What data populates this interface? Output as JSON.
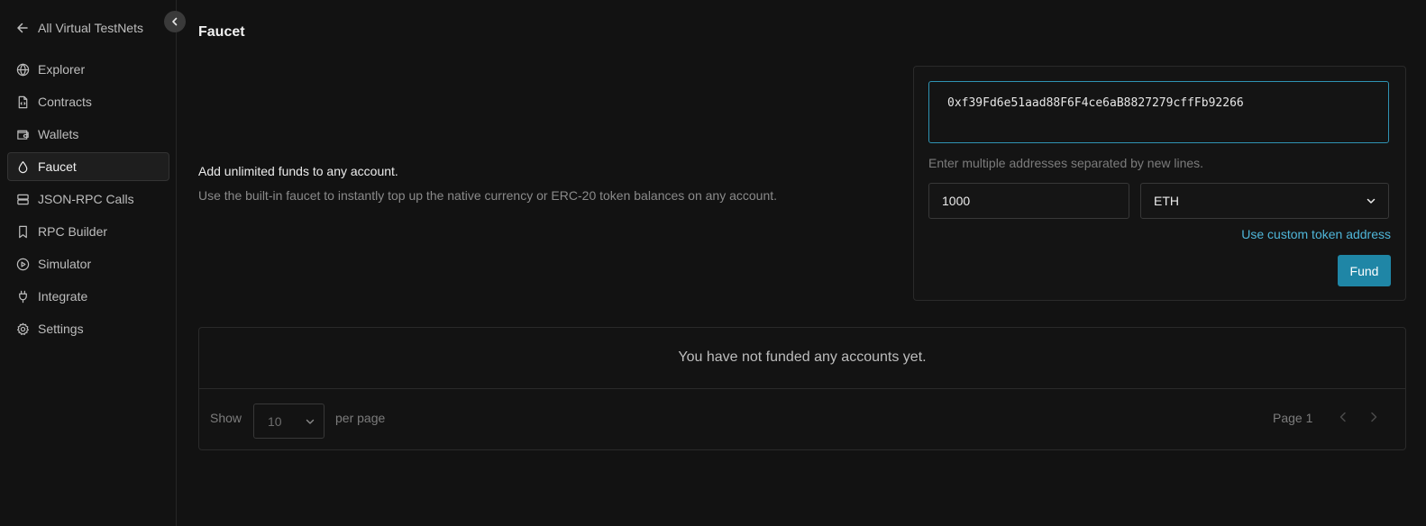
{
  "sidebar": {
    "back_label": "All Virtual TestNets",
    "back_icon": "arrow-left-icon",
    "collapse_icon": "chevron-left-icon",
    "items": [
      {
        "label": "Explorer",
        "icon": "globe-icon"
      },
      {
        "label": "Contracts",
        "icon": "file-code-icon"
      },
      {
        "label": "Wallets",
        "icon": "wallet-icon"
      },
      {
        "label": "Faucet",
        "icon": "droplet-icon",
        "active": true
      },
      {
        "label": "JSON-RPC Calls",
        "icon": "server-icon"
      },
      {
        "label": "RPC Builder",
        "icon": "bookmark-icon"
      },
      {
        "label": "Simulator",
        "icon": "play-circle-icon"
      },
      {
        "label": "Integrate",
        "icon": "plug-icon"
      },
      {
        "label": "Settings",
        "icon": "gear-icon"
      }
    ]
  },
  "page": {
    "title": "Faucet"
  },
  "intro": {
    "title": "Add unlimited funds to any account.",
    "description": "Use the built-in faucet to instantly top up the native currency or ERC-20 token balances on any account."
  },
  "fund_form": {
    "address_value": "0xf39Fd6e51aad88F6F4ce6aB8827279cffFb92266",
    "hint": "Enter multiple addresses separated by new lines.",
    "amount_value": "1000",
    "token_selected": "ETH",
    "custom_token_link": "Use custom token address",
    "fund_button": "Fund"
  },
  "funded_table": {
    "empty_message": "You have not funded any accounts yet.",
    "show_label": "Show",
    "per_page_value": "10",
    "per_page_label": "per page",
    "page_label": "Page 1"
  },
  "colors": {
    "background": "#121212",
    "accent": "#1f86a6",
    "link": "#4fb6d9",
    "focus_border": "#2f93b3"
  }
}
